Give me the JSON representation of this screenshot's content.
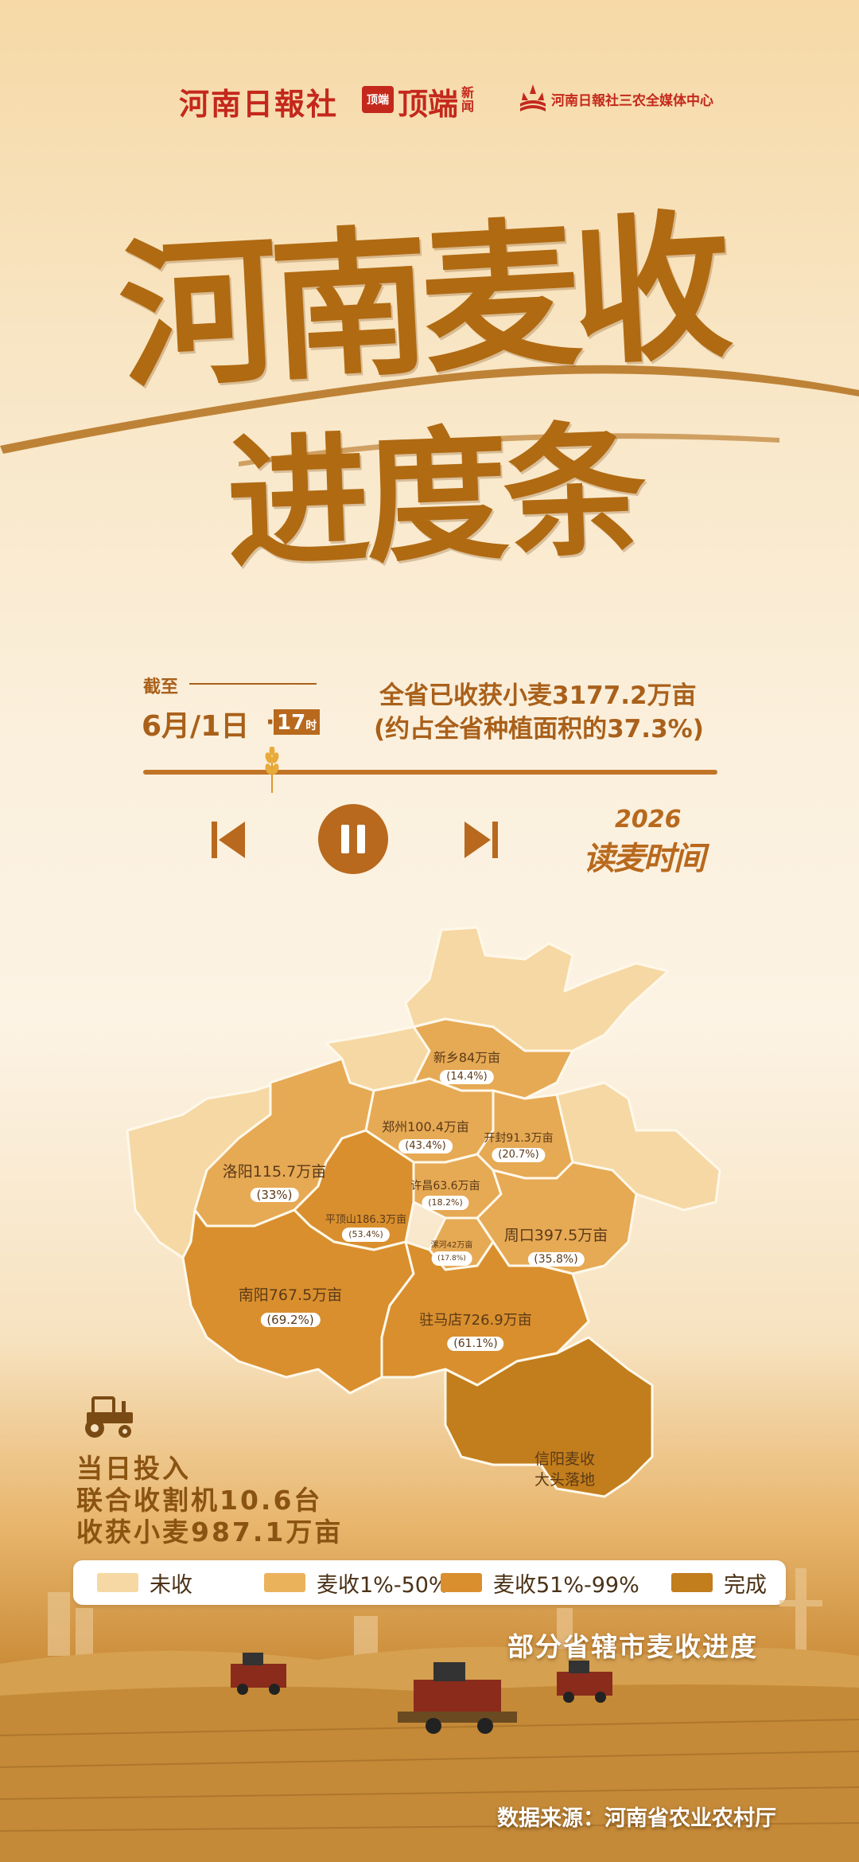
{
  "header": {
    "logo1": "河南日報社",
    "logo2_badge": "顶端",
    "logo2_text": "顶端",
    "logo2_suffix": "新闻",
    "logo3": "河南日報社三农全媒体中心"
  },
  "title": {
    "line1": "河南麦收",
    "line2": "进度条"
  },
  "progress": {
    "as_of_label": "截至",
    "date": "6月/1日",
    "hour": "17",
    "hour_unit": "时",
    "summary_line1": "全省已收获小麦3177.2万亩",
    "summary_line2": "(约占全省种植面积的37.3%)",
    "percent": 37.3
  },
  "player": {
    "prev_icon": "skip-back-icon",
    "pause_icon": "pause-icon",
    "next_icon": "skip-forward-icon",
    "brand_year": "2026",
    "brand_text": "读麦时间"
  },
  "colors": {
    "unharvested": "#f6d8a4",
    "partial_low": "#ebb25c",
    "partial_high": "#d98f2e",
    "done": "#c27d1c"
  },
  "map_labels": [
    {
      "name": "新乡84万亩",
      "pct": "(14.4%)"
    },
    {
      "name": "郑州100.4万亩",
      "pct": "(43.4%)"
    },
    {
      "name": "开封91.3万亩",
      "pct": "(20.7%)"
    },
    {
      "name": "洛阳115.7万亩",
      "pct": "(33%)"
    },
    {
      "name": "许昌63.6万亩",
      "pct": "(18.2%)"
    },
    {
      "name": "平顶山186.3万亩",
      "pct": "(53.4%)"
    },
    {
      "name": "漯河42万亩",
      "pct": "(17.8%)"
    },
    {
      "name": "周口397.5万亩",
      "pct": "(35.8%)"
    },
    {
      "name": "南阳767.5万亩",
      "pct": "(69.2%)"
    },
    {
      "name": "驻马店726.9万亩",
      "pct": "(61.1%)"
    },
    {
      "name": "信阳麦收\n大头落地",
      "pct": ""
    }
  ],
  "daily": {
    "icon": "tractor-icon",
    "line1": "当日投入",
    "line2": "联合收割机10.6台",
    "line3": "收获小麦987.1万亩"
  },
  "legend": [
    {
      "label": "未收"
    },
    {
      "label": "麦收1%-50%"
    },
    {
      "label": "麦收51%-99%"
    },
    {
      "label": "完成"
    }
  ],
  "caption": "部分省辖市麦收进度",
  "source": "数据来源：河南省农业农村厅"
}
